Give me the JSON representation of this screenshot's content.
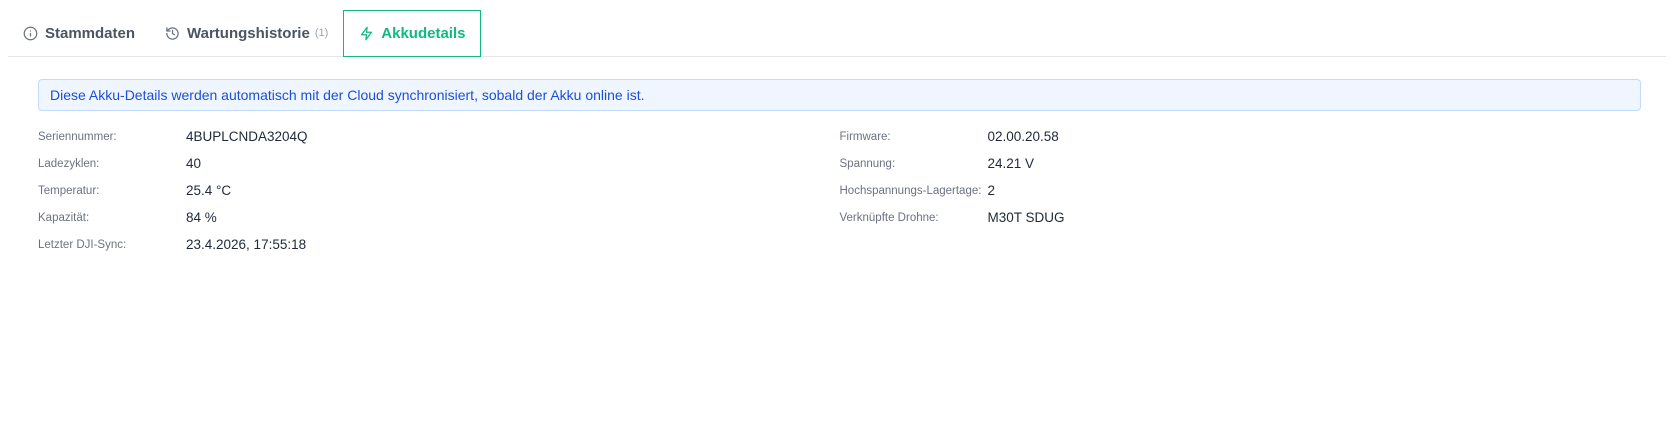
{
  "tabs": [
    {
      "label": "Stammdaten",
      "icon": "info-icon"
    },
    {
      "label": "Wartungshistorie",
      "count": "(1)",
      "icon": "history-icon"
    },
    {
      "label": "Akkudetails",
      "icon": "lightning-icon",
      "active": true
    }
  ],
  "banner": {
    "text": "Diese Akku-Details werden automatisch mit der Cloud synchronisiert, sobald der Akku online ist."
  },
  "details": {
    "left": [
      {
        "label": "Seriennummer:",
        "value": "4BUPLCNDA3204Q"
      },
      {
        "label": "Ladezyklen:",
        "value": "40"
      },
      {
        "label": "Temperatur:",
        "value": "25.4 °C"
      },
      {
        "label": "Kapazität:",
        "value": "84 %"
      },
      {
        "label": "Letzter DJI-Sync:",
        "value": "23.4.2026, 17:55:18"
      }
    ],
    "right": [
      {
        "label": "Firmware:",
        "value": "02.00.20.58"
      },
      {
        "label": "Spannung:",
        "value": "24.21 V"
      },
      {
        "label": "Hochspannungs-Lagertage:",
        "value": "2"
      },
      {
        "label": "Verknüpfte Drohne:",
        "value": "M30T SDUG"
      }
    ]
  },
  "colors": {
    "accent": "#10b981",
    "info_bg": "#eff6ff",
    "info_border": "#bfdbfe",
    "info_text": "#1d4ed8"
  }
}
